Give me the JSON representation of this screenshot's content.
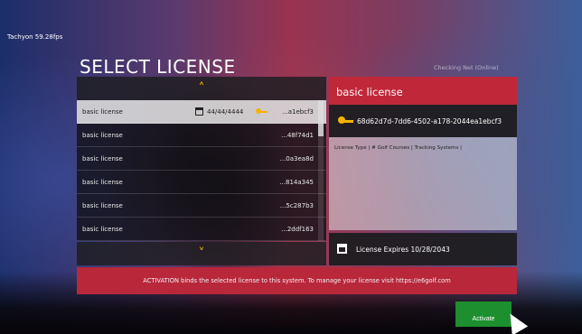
{
  "app": {
    "fps_label": "Tachyon 59.28fps"
  },
  "header": {
    "title": "SELECT LICENSE",
    "checking_label": "Checking Net (Online)"
  },
  "license_list": {
    "rows": [
      {
        "name": "basic license",
        "date": "44/44/4444",
        "key": "...a1ebcf3"
      },
      {
        "name": "basic license",
        "key": "...48f74d1"
      },
      {
        "name": "basic license",
        "key": "...0a3ea8d"
      },
      {
        "name": "basic license",
        "key": "...814a345"
      },
      {
        "name": "basic license",
        "key": "...5c287b3"
      },
      {
        "name": "basic license",
        "key": "...2ddf163"
      }
    ]
  },
  "detail": {
    "title": "basic license",
    "license_key": "68d62d7d-7dd6-4502-a178-2044ea1ebcf3",
    "info": "License Type | # Golf Courses | Tracking Systems |",
    "expires": "License Expires 10/28/2043"
  },
  "banner": {
    "text": "ACTIVATION binds the selected license to this system. To manage your license visit https://e6golf.com"
  },
  "actions": {
    "activate_label": "Activate"
  },
  "colors": {
    "accent_red": "#c0283a",
    "activate_green": "#1e8f2e",
    "key_gold": "#f5b400"
  }
}
